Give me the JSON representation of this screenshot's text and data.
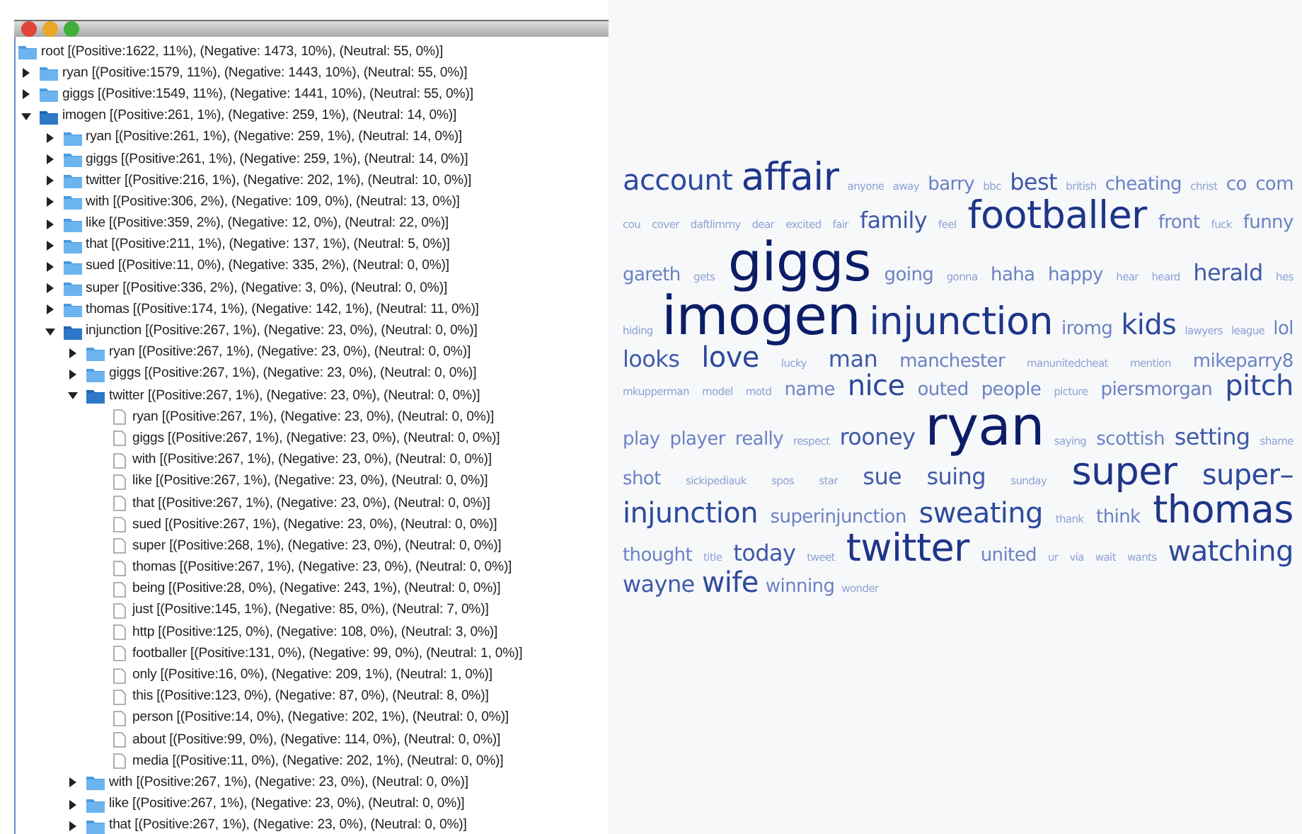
{
  "window": {
    "controls": [
      {
        "kind": "close"
      },
      {
        "kind": "minimize"
      },
      {
        "kind": "zoom"
      }
    ]
  },
  "tree": {
    "label": "root [(Positive:1622, 11%), (Negative: 1473, 10%), (Neutral: 55, 0%)]",
    "kind": "folder",
    "children": [
      {
        "label": "ryan [(Positive:1579, 11%), (Negative: 1443, 10%), (Neutral: 55, 0%)]",
        "kind": "folder",
        "expanded": false
      },
      {
        "label": "giggs [(Positive:1549, 11%), (Negative: 1441, 10%), (Neutral: 55, 0%)]",
        "kind": "folder",
        "expanded": false
      },
      {
        "label": "imogen [(Positive:261, 1%), (Negative: 259, 1%), (Neutral: 14, 0%)]",
        "kind": "folder",
        "expanded": true,
        "children": [
          {
            "label": "ryan [(Positive:261, 1%), (Negative: 259, 1%), (Neutral: 14, 0%)]",
            "kind": "folder",
            "expanded": false
          },
          {
            "label": "giggs [(Positive:261, 1%), (Negative: 259, 1%), (Neutral: 14, 0%)]",
            "kind": "folder",
            "expanded": false
          },
          {
            "label": "twitter [(Positive:216, 1%), (Negative: 202, 1%), (Neutral: 10, 0%)]",
            "kind": "folder",
            "expanded": false
          },
          {
            "label": "with [(Positive:306, 2%), (Negative: 109, 0%), (Neutral: 13, 0%)]",
            "kind": "folder",
            "expanded": false
          },
          {
            "label": "like [(Positive:359, 2%), (Negative: 12, 0%), (Neutral: 22, 0%)]",
            "kind": "folder",
            "expanded": false
          },
          {
            "label": "that [(Positive:211, 1%), (Negative: 137, 1%), (Neutral: 5, 0%)]",
            "kind": "folder",
            "expanded": false
          },
          {
            "label": "sued [(Positive:11, 0%), (Negative: 335, 2%), (Neutral: 0, 0%)]",
            "kind": "folder",
            "expanded": false
          },
          {
            "label": "super [(Positive:336, 2%), (Negative: 3, 0%), (Neutral: 0, 0%)]",
            "kind": "folder",
            "expanded": false
          },
          {
            "label": "thomas [(Positive:174, 1%), (Negative: 142, 1%), (Neutral: 11, 0%)]",
            "kind": "folder",
            "expanded": false
          },
          {
            "label": "injunction [(Positive:267, 1%), (Negative: 23, 0%), (Neutral: 0, 0%)]",
            "kind": "folder",
            "expanded": true,
            "children": [
              {
                "label": "ryan [(Positive:267, 1%), (Negative: 23, 0%), (Neutral: 0, 0%)]",
                "kind": "folder",
                "expanded": false
              },
              {
                "label": "giggs [(Positive:267, 1%), (Negative: 23, 0%), (Neutral: 0, 0%)]",
                "kind": "folder",
                "expanded": false
              },
              {
                "label": "twitter [(Positive:267, 1%), (Negative: 23, 0%), (Neutral: 0, 0%)]",
                "kind": "folder",
                "expanded": true,
                "children": [
                  {
                    "label": "ryan [(Positive:267, 1%), (Negative: 23, 0%), (Neutral: 0, 0%)]",
                    "kind": "leaf"
                  },
                  {
                    "label": "giggs [(Positive:267, 1%), (Negative: 23, 0%), (Neutral: 0, 0%)]",
                    "kind": "leaf"
                  },
                  {
                    "label": "with [(Positive:267, 1%), (Negative: 23, 0%), (Neutral: 0, 0%)]",
                    "kind": "leaf"
                  },
                  {
                    "label": "like [(Positive:267, 1%), (Negative: 23, 0%), (Neutral: 0, 0%)]",
                    "kind": "leaf"
                  },
                  {
                    "label": "that [(Positive:267, 1%), (Negative: 23, 0%), (Neutral: 0, 0%)]",
                    "kind": "leaf"
                  },
                  {
                    "label": "sued [(Positive:267, 1%), (Negative: 23, 0%), (Neutral: 0, 0%)]",
                    "kind": "leaf"
                  },
                  {
                    "label": "super [(Positive:268, 1%), (Negative: 23, 0%), (Neutral: 0, 0%)]",
                    "kind": "leaf"
                  },
                  {
                    "label": "thomas [(Positive:267, 1%), (Negative: 23, 0%), (Neutral: 0, 0%)]",
                    "kind": "leaf"
                  },
                  {
                    "label": "being [(Positive:28, 0%), (Negative: 243, 1%), (Neutral: 0, 0%)]",
                    "kind": "leaf"
                  },
                  {
                    "label": "just [(Positive:145, 1%), (Negative: 85, 0%), (Neutral: 7, 0%)]",
                    "kind": "leaf"
                  },
                  {
                    "label": "http [(Positive:125, 0%), (Negative: 108, 0%), (Neutral: 3, 0%)]",
                    "kind": "leaf"
                  },
                  {
                    "label": "footballer [(Positive:131, 0%), (Negative: 99, 0%), (Neutral: 1, 0%)]",
                    "kind": "leaf"
                  },
                  {
                    "label": "only [(Positive:16, 0%), (Negative: 209, 1%), (Neutral: 1, 0%)]",
                    "kind": "leaf"
                  },
                  {
                    "label": "this [(Positive:123, 0%), (Negative: 87, 0%), (Neutral: 8, 0%)]",
                    "kind": "leaf"
                  },
                  {
                    "label": "person [(Positive:14, 0%), (Negative: 202, 1%), (Neutral: 0, 0%)]",
                    "kind": "leaf"
                  },
                  {
                    "label": "about [(Positive:99, 0%), (Negative: 114, 0%), (Neutral: 0, 0%)]",
                    "kind": "leaf"
                  },
                  {
                    "label": "media [(Positive:11, 0%), (Negative: 202, 1%), (Neutral: 0, 0%)]",
                    "kind": "leaf"
                  }
                ]
              },
              {
                "label": "with [(Positive:267, 1%), (Negative: 23, 0%), (Neutral: 0, 0%)]",
                "kind": "folder",
                "expanded": false
              },
              {
                "label": "like [(Positive:267, 1%), (Negative: 23, 0%), (Neutral: 0, 0%)]",
                "kind": "folder",
                "expanded": false
              },
              {
                "label": "that [(Positive:267, 1%), (Negative: 23, 0%), (Neutral: 0, 0%)]",
                "kind": "folder",
                "expanded": false
              }
            ]
          }
        ]
      }
    ]
  },
  "word_cloud": {
    "lines": [
      [
        {
          "text": "account",
          "kind": "l"
        },
        {
          "text": "affair",
          "kind": "xl"
        },
        {
          "text": "anyone",
          "kind": "xs"
        },
        {
          "text": "away",
          "kind": "xs"
        },
        {
          "text": "barry",
          "kind": "s"
        },
        {
          "text": "bbc",
          "kind": "xs"
        },
        {
          "text": "best",
          "kind": "m"
        },
        {
          "text": "british",
          "kind": "xs"
        },
        {
          "text": "cheating",
          "kind": "s"
        },
        {
          "text": "christ",
          "kind": "xs"
        },
        {
          "text": "co",
          "kind": "s"
        },
        {
          "text": "com",
          "kind": "s"
        }
      ],
      [
        {
          "text": "cou",
          "kind": "xs"
        },
        {
          "text": "cover",
          "kind": "xs"
        },
        {
          "text": "daftlimmy",
          "kind": "xs"
        },
        {
          "text": "dear",
          "kind": "xs"
        },
        {
          "text": "excited",
          "kind": "xs"
        },
        {
          "text": "fair",
          "kind": "xs"
        },
        {
          "text": "family",
          "kind": "m"
        },
        {
          "text": "feel",
          "kind": "xs"
        },
        {
          "text": "footballer",
          "kind": "xl"
        },
        {
          "text": "front",
          "kind": "s"
        },
        {
          "text": "fuck",
          "kind": "xs"
        },
        {
          "text": "funny",
          "kind": "s"
        }
      ],
      [
        {
          "text": "gareth",
          "kind": "s"
        },
        {
          "text": "gets",
          "kind": "xs"
        },
        {
          "text": "giggs",
          "kind": "xxl"
        },
        {
          "text": "going",
          "kind": "s"
        },
        {
          "text": "gonna",
          "kind": "xs"
        },
        {
          "text": "haha",
          "kind": "s"
        },
        {
          "text": "happy",
          "kind": "s"
        },
        {
          "text": "hear",
          "kind": "xs"
        },
        {
          "text": "heard",
          "kind": "xs"
        },
        {
          "text": "herald",
          "kind": "m"
        },
        {
          "text": "hes",
          "kind": "xs"
        }
      ],
      [
        {
          "text": "hiding",
          "kind": "xs"
        },
        {
          "text": "imogen",
          "kind": "xxl"
        },
        {
          "text": "injunction",
          "kind": "xl"
        },
        {
          "text": "iromg",
          "kind": "s"
        },
        {
          "text": "kids",
          "kind": "l"
        },
        {
          "text": "lawyers",
          "kind": "xs"
        },
        {
          "text": "league",
          "kind": "xs"
        },
        {
          "text": "lol",
          "kind": "s"
        }
      ],
      [
        {
          "text": "looks",
          "kind": "m"
        },
        {
          "text": "love",
          "kind": "l"
        },
        {
          "text": "lucky",
          "kind": "xs"
        },
        {
          "text": "man",
          "kind": "m"
        },
        {
          "text": "manchester",
          "kind": "s"
        },
        {
          "text": "manunitedcheat",
          "kind": "xs"
        },
        {
          "text": "mention",
          "kind": "xs"
        },
        {
          "text": "mikeparry8",
          "kind": "s"
        }
      ],
      [
        {
          "text": "mkupperman",
          "kind": "xs"
        },
        {
          "text": "model",
          "kind": "xs"
        },
        {
          "text": "motd",
          "kind": "xs"
        },
        {
          "text": "name",
          "kind": "s"
        },
        {
          "text": "nice",
          "kind": "l"
        },
        {
          "text": "outed",
          "kind": "s"
        },
        {
          "text": "people",
          "kind": "s"
        },
        {
          "text": "picture",
          "kind": "xs"
        },
        {
          "text": "piersmorgan",
          "kind": "s"
        },
        {
          "text": "pitch",
          "kind": "l"
        }
      ],
      [
        {
          "text": "play",
          "kind": "s"
        },
        {
          "text": "player",
          "kind": "s"
        },
        {
          "text": "really",
          "kind": "s"
        },
        {
          "text": "respect",
          "kind": "xs"
        },
        {
          "text": "rooney",
          "kind": "m"
        },
        {
          "text": "ryan",
          "kind": "xxl"
        },
        {
          "text": "saying",
          "kind": "xs"
        },
        {
          "text": "scottish",
          "kind": "s"
        },
        {
          "text": "setting",
          "kind": "m"
        },
        {
          "text": "shame",
          "kind": "xs"
        }
      ],
      [
        {
          "text": "shot",
          "kind": "s"
        },
        {
          "text": "sickipediauk",
          "kind": "xs"
        },
        {
          "text": "spos",
          "kind": "xs"
        },
        {
          "text": "star",
          "kind": "xs"
        },
        {
          "text": "sue",
          "kind": "m"
        },
        {
          "text": "suing",
          "kind": "m"
        },
        {
          "text": "sunday",
          "kind": "xs"
        },
        {
          "text": "super",
          "kind": "xl"
        },
        {
          "text": "super–",
          "kind": "l"
        }
      ],
      [
        {
          "text": "injunction",
          "kind": "l"
        },
        {
          "text": "superinjunction",
          "kind": "s"
        },
        {
          "text": "sweating",
          "kind": "l"
        },
        {
          "text": "thank",
          "kind": "xs"
        },
        {
          "text": "think",
          "kind": "s"
        },
        {
          "text": "thomas",
          "kind": "xl"
        }
      ],
      [
        {
          "text": "thought",
          "kind": "s"
        },
        {
          "text": "title",
          "kind": "xs"
        },
        {
          "text": "today",
          "kind": "m"
        },
        {
          "text": "tweet",
          "kind": "xs"
        },
        {
          "text": "twitter",
          "kind": "xl"
        },
        {
          "text": "united",
          "kind": "s"
        },
        {
          "text": "ur",
          "kind": "xs"
        },
        {
          "text": "via",
          "kind": "xs"
        },
        {
          "text": "wait",
          "kind": "xs"
        },
        {
          "text": "wants",
          "kind": "xs"
        },
        {
          "text": "watching",
          "kind": "l"
        }
      ],
      [
        {
          "text": "wayne",
          "kind": "m"
        },
        {
          "text": "wife",
          "kind": "l"
        },
        {
          "text": "winning",
          "kind": "s"
        },
        {
          "text": "wonder",
          "kind": "xs"
        }
      ]
    ]
  }
}
